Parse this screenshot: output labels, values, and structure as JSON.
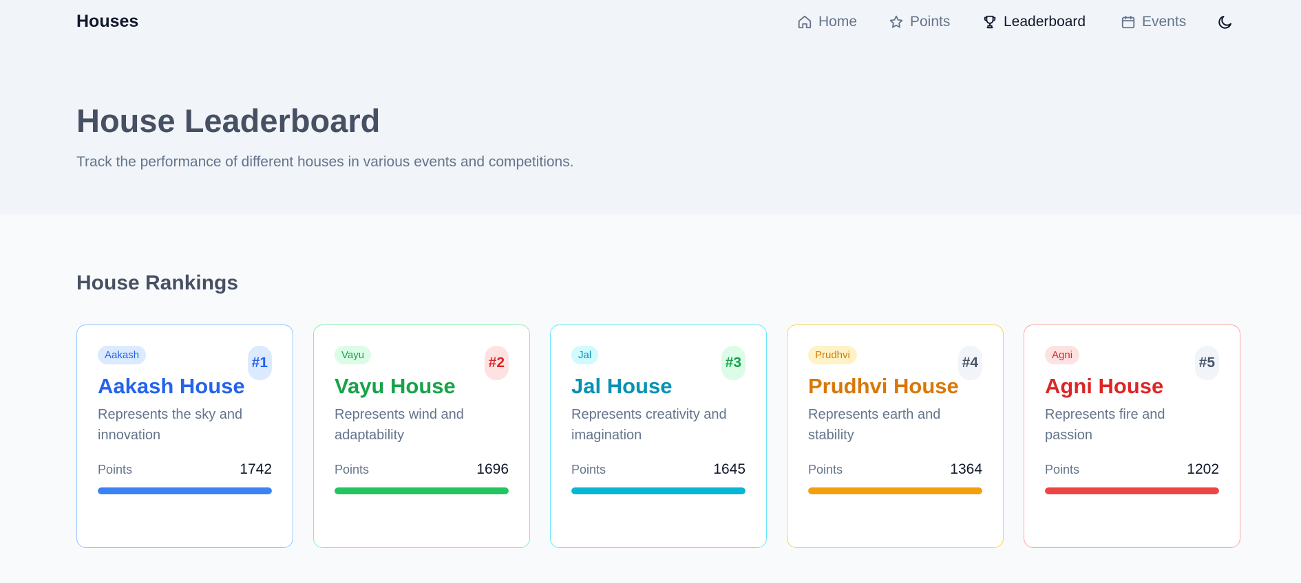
{
  "brand": "Houses",
  "nav": [
    {
      "label": "Home",
      "icon": "home-icon",
      "active": false
    },
    {
      "label": "Points",
      "icon": "star-icon",
      "active": false
    },
    {
      "label": "Leaderboard",
      "icon": "trophy-icon",
      "active": true
    },
    {
      "label": "Events",
      "icon": "calendar-icon",
      "active": false
    }
  ],
  "theme_toggle_icon": "moon-icon",
  "hero": {
    "title": "House Leaderboard",
    "subtitle": "Track the performance of different houses in various events and competitions."
  },
  "section_title": "House Rankings",
  "points_label": "Points",
  "houses": [
    {
      "badge": "Aakash",
      "rank": "#1",
      "title": "Aakash House",
      "desc": "Represents the sky and innovation",
      "points": "1742",
      "fill": 1.0,
      "color": "#2563eb",
      "bar": "#3b82f6",
      "border": "#93c5fd",
      "badge_bg": "#dbeafe",
      "rank_bg": "#dbeafe"
    },
    {
      "badge": "Vayu",
      "rank": "#2",
      "title": "Vayu House",
      "desc": "Represents wind and adaptability",
      "points": "1696",
      "fill": 1.0,
      "color": "#16a34a",
      "bar": "#22c55e",
      "border": "#86efac",
      "badge_bg": "#dcfce7",
      "rank_bg": "#fee2e2",
      "rank_color": "#dc2626"
    },
    {
      "badge": "Jal",
      "rank": "#3",
      "title": "Jal House",
      "desc": "Represents creativity and imagination",
      "points": "1645",
      "fill": 1.0,
      "color": "#0891b2",
      "bar": "#06b6d4",
      "border": "#67e8f9",
      "badge_bg": "#cffafe",
      "rank_bg": "#dcfce7",
      "rank_color": "#16a34a"
    },
    {
      "badge": "Prudhvi",
      "rank": "#4",
      "title": "Prudhvi House",
      "desc": "Represents earth and stability",
      "points": "1364",
      "fill": 1.0,
      "color": "#d97706",
      "bar": "#f59e0b",
      "border": "#fcd34d",
      "badge_bg": "#fef3c7",
      "rank_bg": "#f1f5f9",
      "rank_color": "#475569"
    },
    {
      "badge": "Agni",
      "rank": "#5",
      "title": "Agni House",
      "desc": "Represents fire and passion",
      "points": "1202",
      "fill": 1.0,
      "color": "#dc2626",
      "bar": "#ef4444",
      "border": "#fca5a5",
      "badge_bg": "#fee2e2",
      "rank_bg": "#f1f5f9",
      "rank_color": "#475569"
    }
  ]
}
